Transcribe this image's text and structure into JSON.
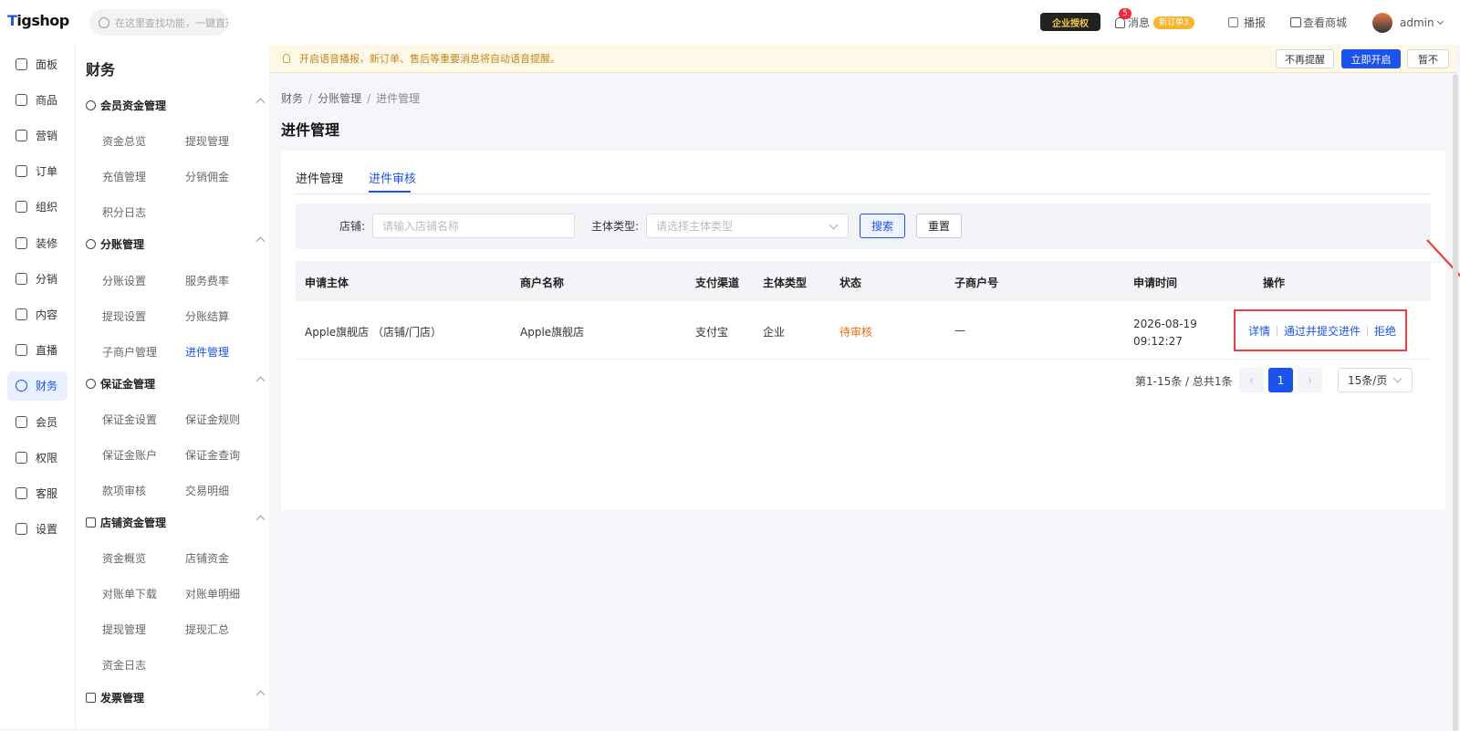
{
  "topbar": {
    "logo_first": "T",
    "logo_rest": "igshop",
    "search_placeholder": "在这里查找功能，一键直达",
    "enterprise_badge": "企业授权",
    "msg_count": "5",
    "msg_label": "消息",
    "new_order": "新订单3",
    "broadcast": "播报",
    "view_mall": "查看商城",
    "user": "admin"
  },
  "leftnav": [
    {
      "label": "面板"
    },
    {
      "label": "商品"
    },
    {
      "label": "营销"
    },
    {
      "label": "订单"
    },
    {
      "label": "组织"
    },
    {
      "label": "装修"
    },
    {
      "label": "分销"
    },
    {
      "label": "内容"
    },
    {
      "label": "直播"
    },
    {
      "label": "财务",
      "active": true
    },
    {
      "label": "会员"
    },
    {
      "label": "权限"
    },
    {
      "label": "客服"
    },
    {
      "label": "设置"
    }
  ],
  "subnav": {
    "title": "财务",
    "groups": [
      {
        "name": "会员资金管理",
        "items": [
          "资金总览",
          "提现管理",
          "充值管理",
          "分销佣金",
          "积分日志"
        ]
      },
      {
        "name": "分账管理",
        "items": [
          "分账设置",
          "服务费率",
          "提现设置",
          "分账结算",
          "子商户管理",
          "进件管理"
        ]
      },
      {
        "name": "保证金管理",
        "items": [
          "保证金设置",
          "保证金规则",
          "保证金账户",
          "保证金查询",
          "款项审核",
          "交易明细"
        ]
      },
      {
        "name": "店铺资金管理",
        "items": [
          "资金概览",
          "店铺资金",
          "对账单下载",
          "对账单明细",
          "提现管理",
          "提现汇总",
          "资金日志"
        ]
      },
      {
        "name": "发票管理",
        "items": []
      }
    ]
  },
  "notice": {
    "text": "开启语音播报，新订单、售后等重要消息将自动语音提醒。",
    "btn_no_remind": "不再提醒",
    "btn_enable": "立即开启",
    "btn_later": "暂不"
  },
  "breadcrumb": [
    "财务",
    "分账管理",
    "进件管理"
  ],
  "page_title": "进件管理",
  "tabs": [
    "进件管理",
    "进件审核"
  ],
  "filter": {
    "shop_label": "店铺:",
    "shop_placeholder": "请输入店铺名称",
    "type_label": "主体类型:",
    "type_placeholder": "请选择主体类型",
    "search_btn": "搜索",
    "reset_btn": "重置"
  },
  "table": {
    "headers": [
      "申请主体",
      "商户名称",
      "支付渠道",
      "主体类型",
      "状态",
      "子商户号",
      "申请时间",
      "操作"
    ],
    "rows": [
      {
        "subject": "Apple旗舰店 （店铺/门店）",
        "merchant": "Apple旗舰店",
        "channel": "支付宝",
        "type": "企业",
        "status": "待审核",
        "sub_no": "—",
        "date": "2026-08-19",
        "time": "09:12:27",
        "op_detail": "详情",
        "op_pass": "通过并提交进件",
        "op_reject": "拒绝"
      }
    ]
  },
  "pager": {
    "summary": "第1-15条 / 总共1条",
    "current": "1",
    "prev": "‹",
    "next": "›",
    "page_size": "15条/页"
  },
  "colors": {
    "primary": "#1a53f0",
    "pending": "#f06b13",
    "highlight": "#ef3f3f"
  }
}
